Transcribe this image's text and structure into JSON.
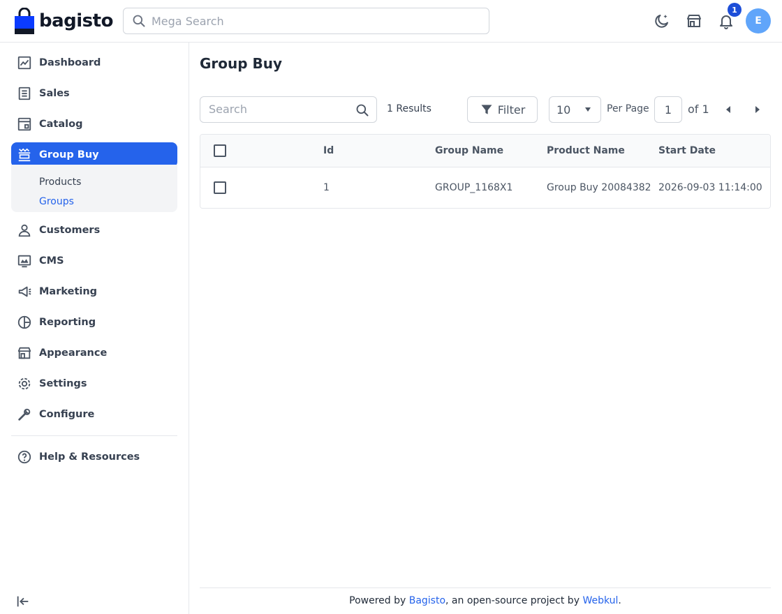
{
  "header": {
    "logo_text": "bagisto",
    "search_placeholder": "Mega Search",
    "notification_count": "1",
    "avatar_initial": "E"
  },
  "sidebar": {
    "items": [
      {
        "label": "Dashboard",
        "icon": "dashboard-icon"
      },
      {
        "label": "Sales",
        "icon": "receipt-icon"
      },
      {
        "label": "Catalog",
        "icon": "catalog-icon"
      },
      {
        "label": "Group Buy",
        "icon": "group-buy-icon",
        "active": true
      },
      {
        "label": "Customers",
        "icon": "user-icon"
      },
      {
        "label": "CMS",
        "icon": "cms-icon"
      },
      {
        "label": "Marketing",
        "icon": "megaphone-icon"
      },
      {
        "label": "Reporting",
        "icon": "pie-chart-icon"
      },
      {
        "label": "Appearance",
        "icon": "store-icon"
      },
      {
        "label": "Settings",
        "icon": "gear-icon"
      },
      {
        "label": "Configure",
        "icon": "wrench-icon"
      }
    ],
    "submenu": [
      {
        "label": "Products"
      },
      {
        "label": "Groups",
        "current": true
      }
    ],
    "help_label": "Help & Resources"
  },
  "main": {
    "title": "Group Buy",
    "search_placeholder": "Search",
    "results_text": "1 Results",
    "filter_label": "Filter",
    "per_page_value": "10",
    "per_page_label": "Per Page",
    "current_page": "1",
    "of_pages": "of 1",
    "columns": [
      "Id",
      "Group Name",
      "Product Name",
      "Start Date"
    ],
    "rows": [
      {
        "id": "1",
        "group_name": "GROUP_1168X1",
        "product_name": "Group Buy 20084382",
        "start_date": "2026-09-03 11:14:00"
      }
    ]
  },
  "footer": {
    "prefix": "Powered by ",
    "link1": "Bagisto",
    "middle": ", an open-source project by ",
    "link2": "Webkul",
    "suffix": "."
  },
  "colors": {
    "accent": "#2563eb",
    "badge": "#1d4ed8",
    "avatar": "#60a5fa"
  }
}
